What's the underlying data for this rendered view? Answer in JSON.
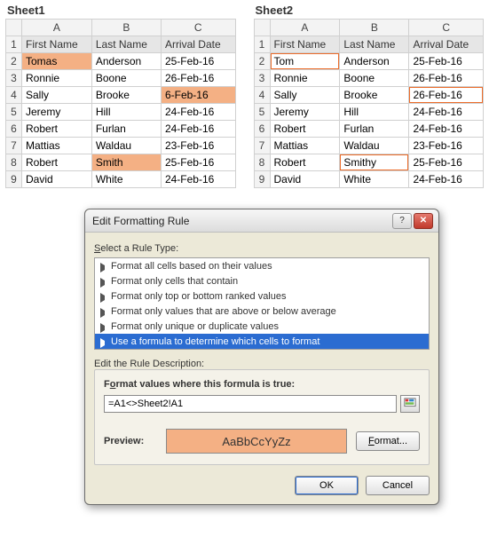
{
  "sheets": {
    "s1": {
      "title": "Sheet1",
      "cols": [
        "A",
        "B",
        "C"
      ],
      "headers": [
        "First Name",
        "Last Name",
        "Arrival Date"
      ],
      "rows": [
        {
          "n": "1"
        },
        {
          "n": "2",
          "a": "Tomas",
          "b": "Anderson",
          "c": "25-Feb-16",
          "hlA": true
        },
        {
          "n": "3",
          "a": "Ronnie",
          "b": "Boone",
          "c": "26-Feb-16"
        },
        {
          "n": "4",
          "a": "Sally",
          "b": "Brooke",
          "c": "6-Feb-16",
          "hlC": true
        },
        {
          "n": "5",
          "a": "Jeremy",
          "b": "Hill",
          "c": "24-Feb-16"
        },
        {
          "n": "6",
          "a": "Robert",
          "b": "Furlan",
          "c": "24-Feb-16"
        },
        {
          "n": "7",
          "a": "Mattias",
          "b": "Waldau",
          "c": "23-Feb-16"
        },
        {
          "n": "8",
          "a": "Robert",
          "b": "Smith",
          "c": "25-Feb-16",
          "hlB": true
        },
        {
          "n": "9",
          "a": "David",
          "b": "White",
          "c": "24-Feb-16"
        }
      ]
    },
    "s2": {
      "title": "Sheet2",
      "cols": [
        "A",
        "B",
        "C"
      ],
      "headers": [
        "First Name",
        "Last Name",
        "Arrival Date"
      ],
      "rows": [
        {
          "n": "1"
        },
        {
          "n": "2",
          "a": "Tom",
          "b": "Anderson",
          "c": "25-Feb-16",
          "mkA": true
        },
        {
          "n": "3",
          "a": "Ronnie",
          "b": "Boone",
          "c": "26-Feb-16"
        },
        {
          "n": "4",
          "a": "Sally",
          "b": "Brooke",
          "c": "26-Feb-16",
          "mkC": true
        },
        {
          "n": "5",
          "a": "Jeremy",
          "b": "Hill",
          "c": "24-Feb-16"
        },
        {
          "n": "6",
          "a": "Robert",
          "b": "Furlan",
          "c": "24-Feb-16"
        },
        {
          "n": "7",
          "a": "Mattias",
          "b": "Waldau",
          "c": "23-Feb-16"
        },
        {
          "n": "8",
          "a": "Robert",
          "b": "Smithy",
          "c": "25-Feb-16",
          "mkB": true
        },
        {
          "n": "9",
          "a": "David",
          "b": "White",
          "c": "24-Feb-16"
        }
      ]
    }
  },
  "dialog": {
    "title": "Edit Formatting Rule",
    "select_label": "Select a Rule Type:",
    "rules": [
      "Format all cells based on their values",
      "Format only cells that contain",
      "Format only top or bottom ranked values",
      "Format only values that are above or below average",
      "Format only unique or duplicate values",
      "Use a formula to determine which cells to format"
    ],
    "selected_rule_index": 5,
    "edit_label": "Edit the Rule Description:",
    "formula_label": "Format values where this formula is true:",
    "formula_value": "=A1<>Sheet2!A1",
    "preview_label": "Preview:",
    "preview_text": "AaBbCcYyZz",
    "format_btn": "Format...",
    "ok_btn": "OK",
    "cancel_btn": "Cancel",
    "help_symbol": "?",
    "close_symbol": "✕",
    "preview_bg": "#f4b084"
  }
}
